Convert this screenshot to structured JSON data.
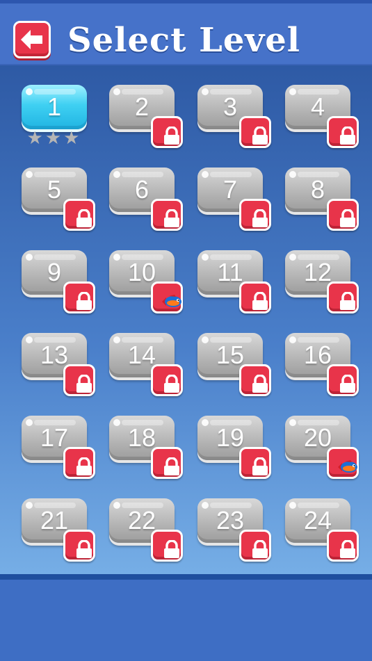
{
  "header": {
    "title": "Select Level",
    "back_icon": "arrow-left-icon"
  },
  "levels": [
    {
      "number": "1",
      "state": "unlocked",
      "stars": 0
    },
    {
      "number": "2",
      "state": "locked"
    },
    {
      "number": "3",
      "state": "locked"
    },
    {
      "number": "4",
      "state": "locked"
    },
    {
      "number": "5",
      "state": "locked"
    },
    {
      "number": "6",
      "state": "locked"
    },
    {
      "number": "7",
      "state": "locked"
    },
    {
      "number": "8",
      "state": "locked"
    },
    {
      "number": "9",
      "state": "locked"
    },
    {
      "number": "10",
      "state": "locked-fish"
    },
    {
      "number": "11",
      "state": "locked"
    },
    {
      "number": "12",
      "state": "locked"
    },
    {
      "number": "13",
      "state": "locked"
    },
    {
      "number": "14",
      "state": "locked"
    },
    {
      "number": "15",
      "state": "locked"
    },
    {
      "number": "16",
      "state": "locked"
    },
    {
      "number": "17",
      "state": "locked"
    },
    {
      "number": "18",
      "state": "locked"
    },
    {
      "number": "19",
      "state": "locked"
    },
    {
      "number": "20",
      "state": "locked-fish"
    },
    {
      "number": "21",
      "state": "locked"
    },
    {
      "number": "22",
      "state": "locked"
    },
    {
      "number": "23",
      "state": "locked"
    },
    {
      "number": "24",
      "state": "locked"
    }
  ],
  "colors": {
    "accent_red": "#e8344a",
    "active_tile": "#3fd0f2",
    "locked_tile": "#b6b6b6",
    "header_bg": "#4672c9"
  }
}
